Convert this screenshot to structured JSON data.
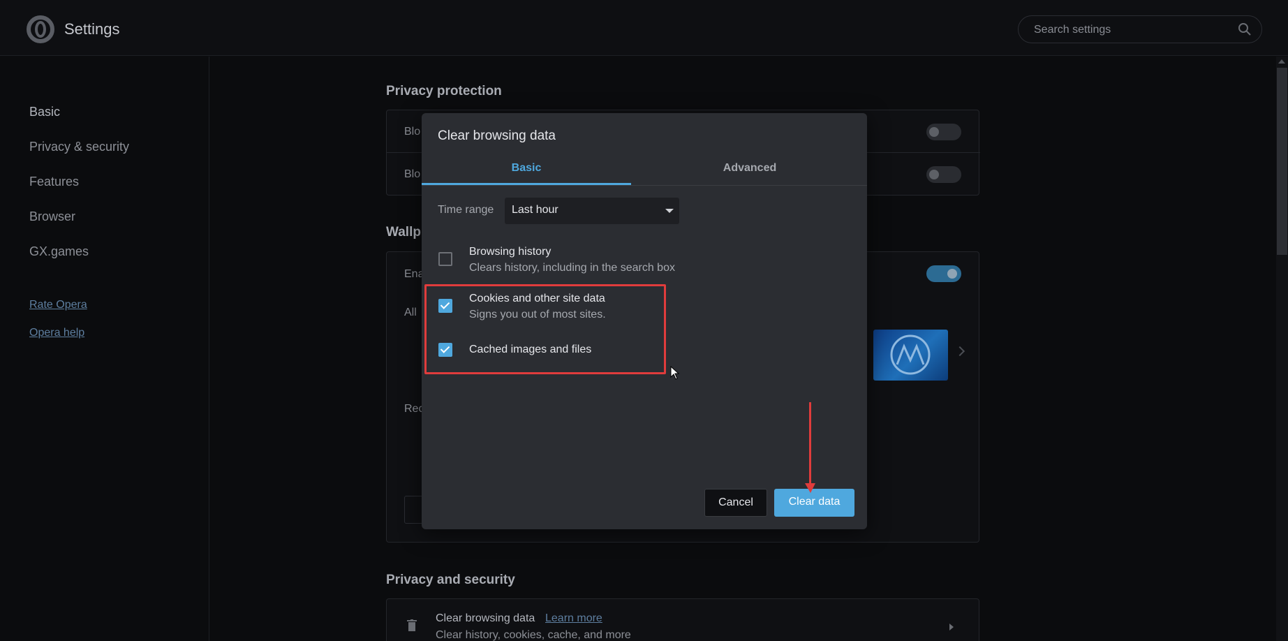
{
  "app": {
    "title": "Settings"
  },
  "search": {
    "placeholder": "Search settings"
  },
  "sidebar": {
    "items": [
      {
        "label": "Basic"
      },
      {
        "label": "Privacy & security"
      },
      {
        "label": "Features"
      },
      {
        "label": "Browser"
      },
      {
        "label": "GX.games"
      }
    ],
    "links": [
      {
        "label": "Rate Opera"
      },
      {
        "label": "Opera help"
      }
    ]
  },
  "main": {
    "privacy_protection": {
      "title": "Privacy protection",
      "rows": [
        {
          "label": "Blo",
          "toggle": false
        },
        {
          "label": "Blo",
          "toggle": false
        }
      ]
    },
    "wallpapers": {
      "title": "Wallp",
      "enable_label": "Ena",
      "enable_toggle": true,
      "all_label": "All",
      "rec_label": "Rec"
    },
    "privacy_security": {
      "title": "Privacy and security",
      "clear_browsing_data": {
        "title": "Clear browsing data",
        "learn_more": "Learn more",
        "subtitle": "Clear history, cookies, cache, and more"
      }
    }
  },
  "dialog": {
    "title": "Clear browsing data",
    "tabs": [
      {
        "label": "Basic",
        "active": true
      },
      {
        "label": "Advanced",
        "active": false
      }
    ],
    "time_range": {
      "label": "Time range",
      "value": "Last hour"
    },
    "items": [
      {
        "title": "Browsing history",
        "subtitle": "Clears history, including in the search box",
        "checked": false
      },
      {
        "title": "Cookies and other site data",
        "subtitle": "Signs you out of most sites.",
        "checked": true
      },
      {
        "title": "Cached images and files",
        "subtitle": "",
        "checked": true
      }
    ],
    "buttons": {
      "cancel": "Cancel",
      "confirm": "Clear data"
    }
  },
  "colors": {
    "accent": "#4fa8de",
    "annotation": "#e03c3c",
    "background": "#0b0c0e",
    "dialog": "#2b2d32"
  }
}
